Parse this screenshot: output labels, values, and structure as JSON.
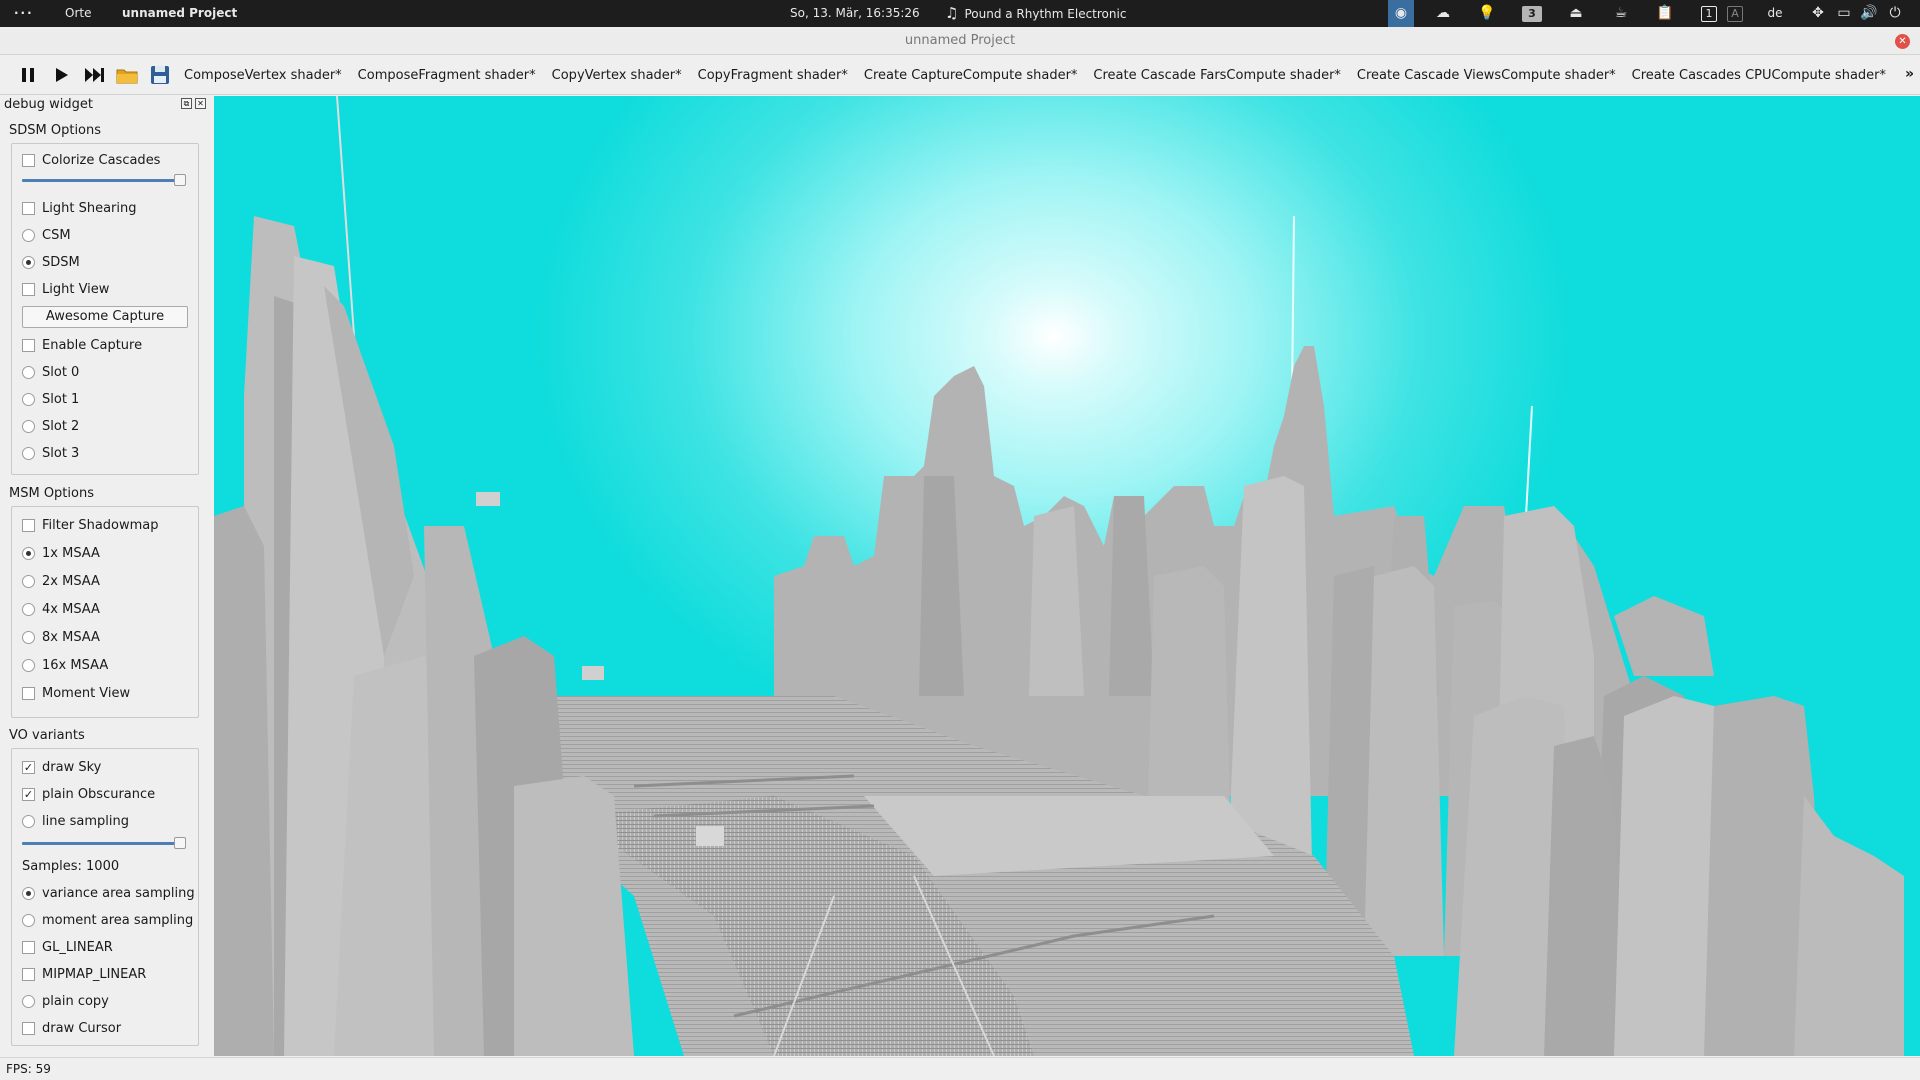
{
  "topbar": {
    "menu_dots": "···",
    "places": "Orte",
    "active_app": "unnamed Project",
    "clock": "So, 13. Mär, 16:35:26",
    "now_playing": "Pound a Rhythm Electronic",
    "workspace_badge": "3",
    "workspace_1": "1",
    "workspace_2": "A",
    "keyboard_layout": "de"
  },
  "window": {
    "title": "unnamed Project",
    "close_glyph": "✕"
  },
  "toolbar": {
    "tabs": [
      "ComposeVertex shader*",
      "ComposeFragment shader*",
      "CopyVertex shader*",
      "CopyFragment shader*",
      "Create CaptureCompute shader*",
      "Create Cascade FarsCompute shader*",
      "Create Cascade ViewsCompute shader*",
      "Create Cascades CPUCompute shader*"
    ],
    "more_glyph": "»"
  },
  "panel": {
    "title": "debug widget",
    "sdsm": {
      "title": "SDSM Options",
      "colorize_cascades": "Colorize Cascades",
      "slider_level": 1.0,
      "light_shearing": "Light Shearing",
      "csm": "CSM",
      "sdsm": "SDSM",
      "light_view": "Light View",
      "capture_button": "Awesome Capture",
      "enable_capture": "Enable Capture",
      "slot0": "Slot 0",
      "slot1": "Slot 1",
      "slot2": "Slot 2",
      "slot3": "Slot 3"
    },
    "msm": {
      "title": "MSM Options",
      "filter_shadowmap": "Filter Shadowmap",
      "msaa1": "1x MSAA",
      "msaa2": "2x MSAA",
      "msaa4": "4x MSAA",
      "msaa8": "8x MSAA",
      "msaa16": "16x MSAA",
      "moment_view": "Moment View"
    },
    "vo": {
      "title": "VO variants",
      "draw_sky": "draw Sky",
      "plain_obscurance": "plain Obscurance",
      "line_sampling": "line sampling",
      "slider_level": 1.0,
      "samples": "Samples: 1000",
      "variance_area": "variance area sampling",
      "moment_area": "moment area sampling",
      "gl_linear": "GL_LINEAR",
      "mipmap_linear": "MIPMAP_LINEAR",
      "plain_copy": "plain copy",
      "draw_cursor": "draw Cursor"
    }
  },
  "status": {
    "fps": "FPS: 59"
  },
  "colors": {
    "sky_cyan": "#0fdcdc",
    "building_gray": "#b4b4b4",
    "slider_blue": "#4d7fb5",
    "topbar_bg": "#1d1d1d"
  }
}
